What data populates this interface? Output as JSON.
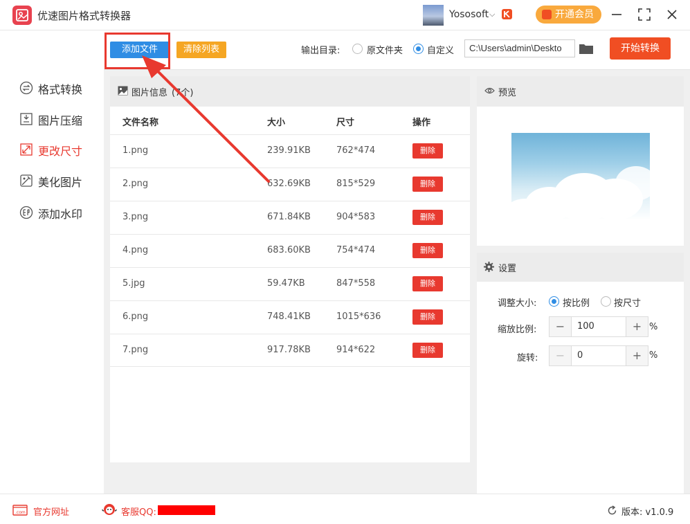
{
  "app": {
    "title": "优速图片格式转换器"
  },
  "user": {
    "name": "Yososoft",
    "chevron": "⌵"
  },
  "vip": {
    "label": "开通会员"
  },
  "toolbar": {
    "add_label": "添加文件",
    "clear_label": "清除列表",
    "output_label": "输出目录:",
    "opt_original": "原文件夹",
    "opt_custom": "自定义",
    "selected_output": "custom",
    "path_value": "C:\\Users\\admin\\Deskto",
    "start_label": "开始转换"
  },
  "sidebar": {
    "items": [
      {
        "label": "格式转换",
        "icon": "format-convert-icon",
        "active": false
      },
      {
        "label": "图片压缩",
        "icon": "compress-icon",
        "active": false
      },
      {
        "label": "更改尺寸",
        "icon": "resize-icon",
        "active": true
      },
      {
        "label": "美化图片",
        "icon": "beautify-icon",
        "active": false
      },
      {
        "label": "添加水印",
        "icon": "watermark-icon",
        "active": false
      }
    ]
  },
  "files": {
    "header_label": "图片信息",
    "count_label": "(7个)",
    "columns": [
      "文件名称",
      "大小",
      "尺寸",
      "操作"
    ],
    "delete_label": "删除",
    "rows": [
      {
        "name": "1.png",
        "size": "239.91KB",
        "dim": "762*474"
      },
      {
        "name": "2.png",
        "size": "632.69KB",
        "dim": "815*529"
      },
      {
        "name": "3.png",
        "size": "671.84KB",
        "dim": "904*583"
      },
      {
        "name": "4.png",
        "size": "683.60KB",
        "dim": "754*474"
      },
      {
        "name": "5.jpg",
        "size": "59.47KB",
        "dim": "847*558"
      },
      {
        "name": "6.png",
        "size": "748.41KB",
        "dim": "1015*636"
      },
      {
        "name": "7.png",
        "size": "917.78KB",
        "dim": "914*622"
      }
    ]
  },
  "preview": {
    "label": "预览"
  },
  "settings": {
    "label": "设置",
    "resize_label": "调整大小:",
    "opt_ratio": "按比例",
    "opt_size": "按尺寸",
    "selected": "ratio",
    "scale_label": "缩放比例:",
    "scale_value": "100",
    "rotate_label": "旋转:",
    "rotate_value": "0",
    "minus": "−",
    "plus": "+",
    "pct": "%"
  },
  "footer": {
    "website_label": "官方网址",
    "qq_label": "客服QQ:",
    "version_label": "版本:",
    "version_value": "v1.0.9"
  },
  "colors": {
    "accent_blue": "#2f8de4",
    "accent_red": "#e8392f",
    "accent_orange": "#f5a623",
    "start_red": "#f04e23"
  }
}
